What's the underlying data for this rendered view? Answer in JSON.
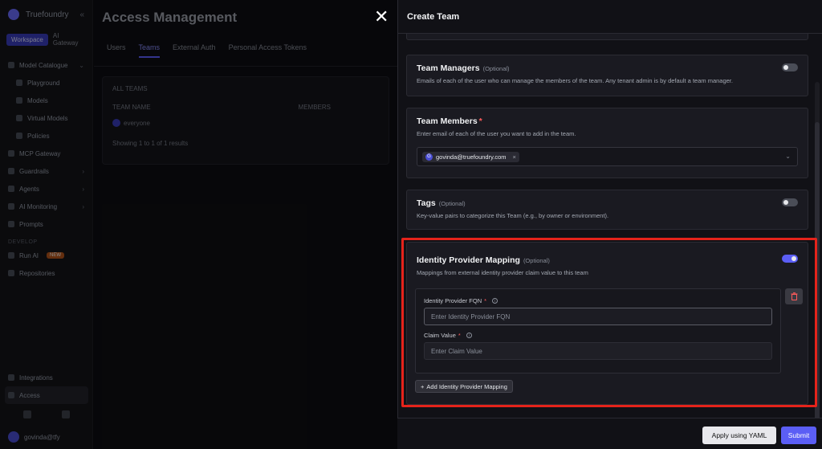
{
  "background": {
    "brand": "Truefoundry",
    "tenant_pill": "Workspace",
    "tenant_name": "AI Gateway",
    "sidebar_items": [
      {
        "label": "Model Catalogue",
        "sub": false,
        "chev": "⌄"
      },
      {
        "label": "Playground",
        "sub": true,
        "chev": ""
      },
      {
        "label": "Models",
        "sub": true,
        "chev": ""
      },
      {
        "label": "Virtual Models",
        "sub": true,
        "chev": ""
      },
      {
        "label": "Policies",
        "sub": true,
        "chev": ""
      },
      {
        "label": "MCP Gateway",
        "sub": false,
        "chev": ""
      },
      {
        "label": "Guardrails",
        "sub": false,
        "chev": "›"
      },
      {
        "label": "Agents",
        "sub": false,
        "chev": "›"
      },
      {
        "label": "AI Monitoring",
        "sub": false,
        "chev": "›"
      },
      {
        "label": "Prompts",
        "sub": false,
        "chev": ""
      }
    ],
    "section_label": "DEVELOP",
    "extra_items": [
      {
        "label": "Run AI",
        "badge": "NEW"
      },
      {
        "label": "Repositories",
        "badge": ""
      }
    ],
    "bottom_items": [
      {
        "label": "Integrations"
      },
      {
        "label": "Access"
      }
    ],
    "user": "govinda@tfy",
    "main_title": "Access Management",
    "tabs": [
      "Users",
      "Teams",
      "External Auth",
      "Personal Access Tokens"
    ],
    "panel_label": "ALL TEAMS",
    "col_team_name": "TEAM NAME",
    "col_members": "MEMBERS",
    "team_name": "everyone",
    "showing": "Showing 1 to 1 of 1 results"
  },
  "drawer": {
    "title": "Create Team",
    "team_managers": {
      "title": "Team Managers",
      "optional": "(Optional)",
      "desc": "Emails of each of the user who can manage the members of the team. Any tenant admin is by default a team manager."
    },
    "team_members": {
      "title": "Team Members",
      "required": "*",
      "desc": "Enter email of each of the user you want to add in the team.",
      "chip_initial": "G",
      "chip_email": "govinda@truefoundry.com",
      "chip_remove": "×"
    },
    "tags": {
      "title": "Tags",
      "optional": "(Optional)",
      "desc": "Key-value pairs to categorize this Team (e.g., by owner or environment)."
    },
    "idp_mapping": {
      "title": "Identity Provider Mapping",
      "optional": "(Optional)",
      "desc": "Mappings from external identity provider claim value to this team",
      "fqn_label": "Identity Provider FQN",
      "fqn_placeholder": "Enter Identity Provider FQN",
      "claim_label": "Claim Value",
      "claim_placeholder": "Enter Claim Value",
      "required": "*",
      "add_label": "Add Identity Provider Mapping",
      "add_prefix": "+"
    },
    "footer": {
      "yaml_label": "Apply using YAML",
      "submit_label": "Submit"
    }
  },
  "colors": {
    "accent": "#5b5ef5",
    "highlight": "#e5231b",
    "required": "#ff5b5b"
  }
}
